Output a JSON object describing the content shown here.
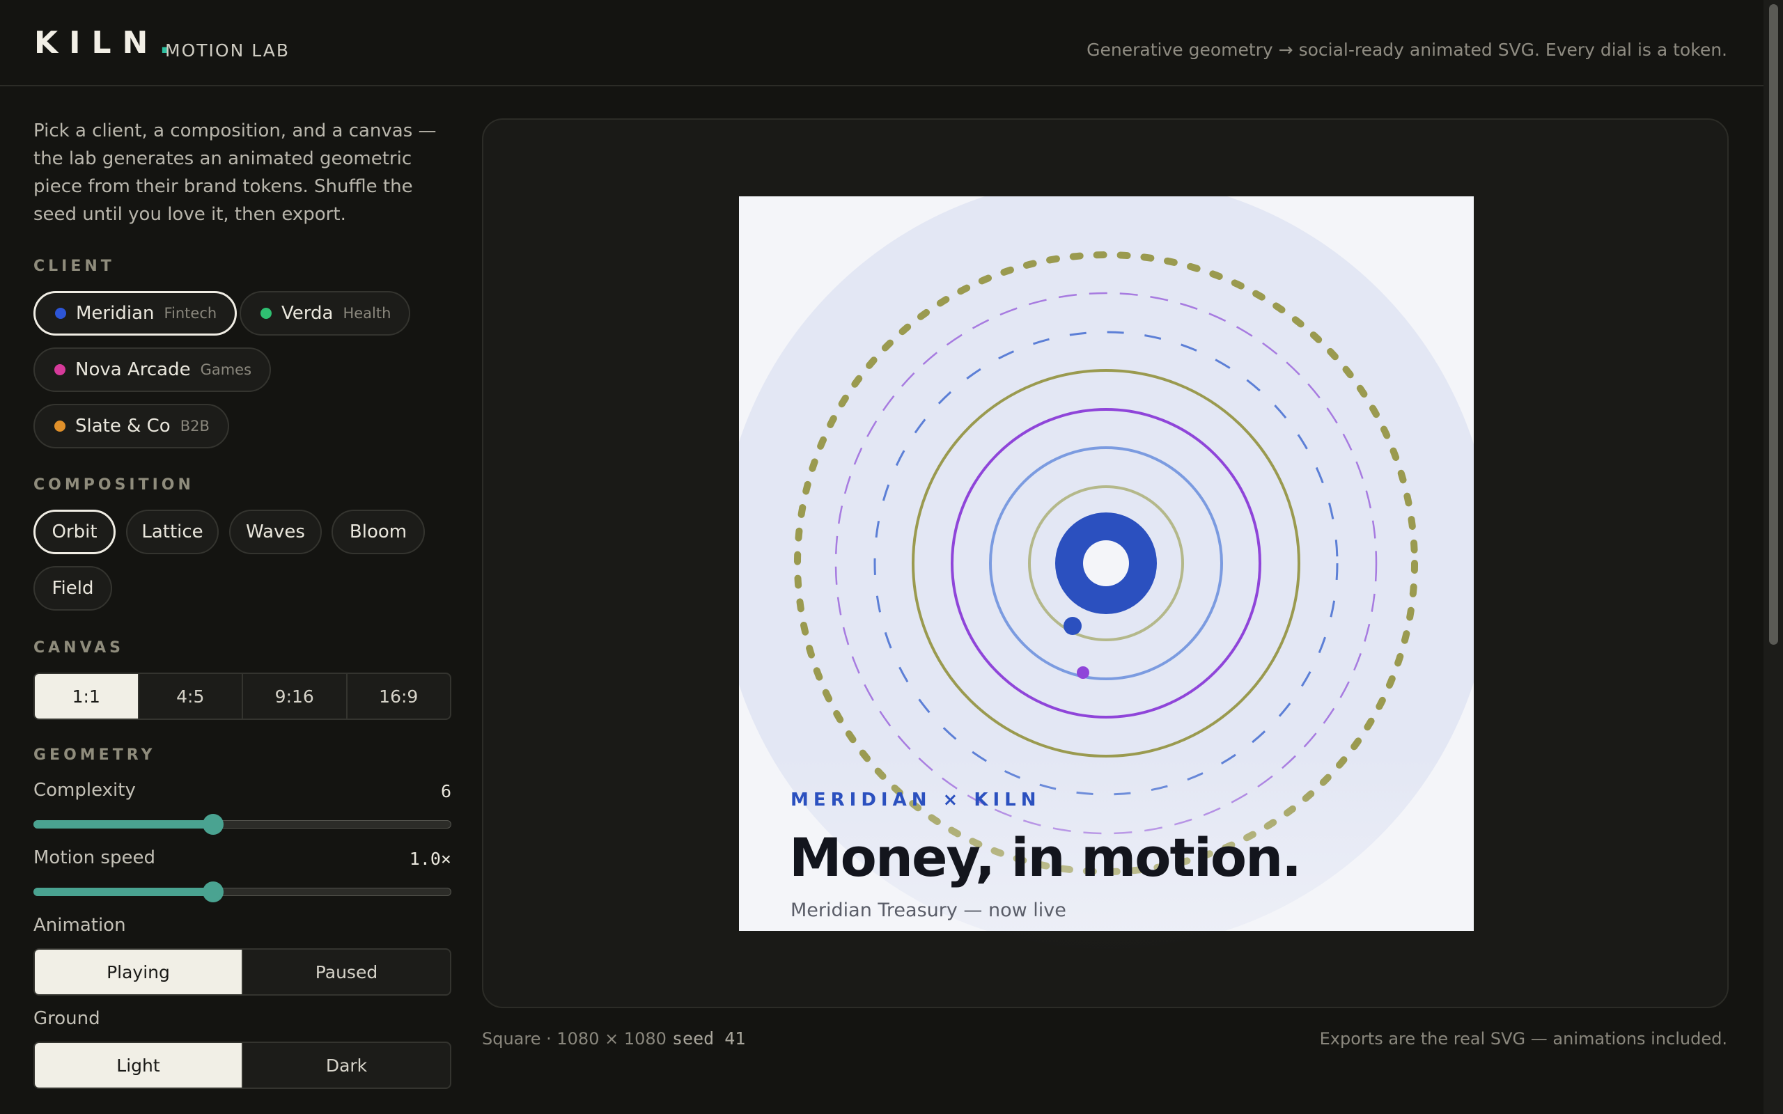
{
  "header": {
    "logo": "KILN",
    "logo_dot": ".",
    "title": "MOTION LAB",
    "tagline": "Generative geometry → social-ready animated SVG. Every dial is a token."
  },
  "sidebar": {
    "intro": "Pick a client, a composition, and a canvas — the lab generates an animated geometric piece from their brand tokens. Shuffle the seed until you love it, then export.",
    "client_label": "CLIENT",
    "clients": [
      {
        "name": "Meridian",
        "tag": "Fintech",
        "color": "#2d55d6",
        "active": true
      },
      {
        "name": "Verda",
        "tag": "Health",
        "color": "#2fbf71",
        "active": false
      },
      {
        "name": "Nova Arcade",
        "tag": "Games",
        "color": "#d63a9a",
        "active": false
      },
      {
        "name": "Slate & Co",
        "tag": "B2B",
        "color": "#e0902a",
        "active": false
      }
    ],
    "composition_label": "COMPOSITION",
    "compositions": [
      "Orbit",
      "Lattice",
      "Waves",
      "Bloom",
      "Field"
    ],
    "canvas_label": "CANVAS",
    "canvases": [
      "1:1",
      "4:5",
      "9:16",
      "16:9"
    ],
    "geometry_label": "GEOMETRY",
    "complexity": {
      "label": "Complexity",
      "value": "6",
      "fraction": 0.43
    },
    "motion": {
      "label": "Motion speed",
      "value": "1.0×",
      "fraction": 0.43
    },
    "animation": {
      "label": "Animation",
      "options": [
        "Playing",
        "Paused"
      ]
    },
    "ground": {
      "label": "Ground",
      "options": [
        "Light",
        "Dark"
      ]
    }
  },
  "artboard": {
    "eyebrow": "MERIDIAN × KILN",
    "headline": "Money, in motion.",
    "sub": "Meridian Treasury — now live",
    "colors": {
      "primary": "#2d55d6",
      "violet": "#8f45d9",
      "olive": "#9a9a4f",
      "soft_blue": "#7b9be0"
    }
  },
  "footer": {
    "format": "Square · 1080 × 1080",
    "seed": "seed 41",
    "note": "Exports are the real SVG — animations included."
  }
}
